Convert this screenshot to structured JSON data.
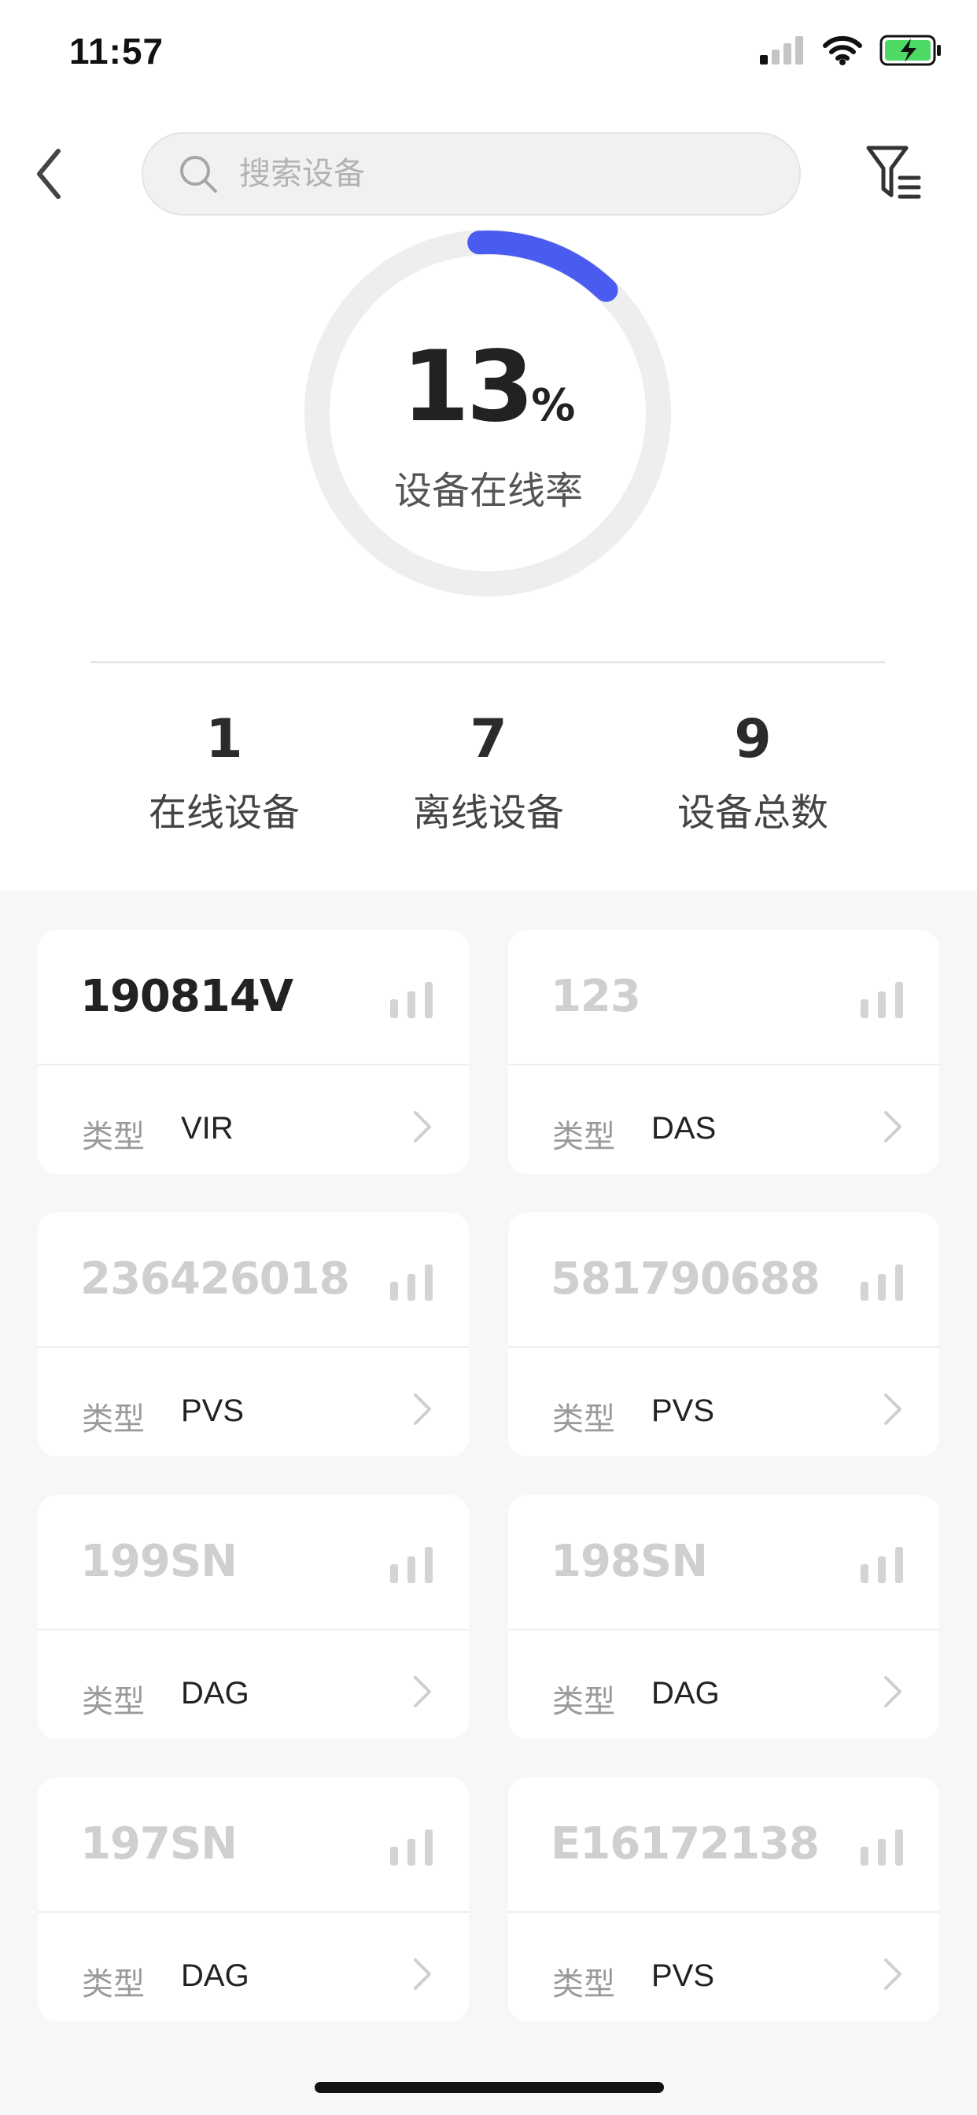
{
  "status_bar": {
    "time": "11:57"
  },
  "search": {
    "placeholder": "搜索设备",
    "value": ""
  },
  "gauge": {
    "rate_value": "13",
    "rate_unit": "%",
    "rate_fraction": 0.13,
    "label": "设备在线率"
  },
  "stats": [
    {
      "value": "1",
      "label": "在线设备"
    },
    {
      "value": "7",
      "label": "离线设备"
    },
    {
      "value": "9",
      "label": "设备总数"
    }
  ],
  "devices": [
    {
      "name": "190814V",
      "type_label": "类型",
      "type": "VIR",
      "online": true
    },
    {
      "name": "123",
      "type_label": "类型",
      "type": "DAS",
      "online": false
    },
    {
      "name": "236426018",
      "type_label": "类型",
      "type": "PVS",
      "online": false
    },
    {
      "name": "581790688",
      "type_label": "类型",
      "type": "PVS",
      "online": false
    },
    {
      "name": "199SN",
      "type_label": "类型",
      "type": "DAG",
      "online": false
    },
    {
      "name": "198SN",
      "type_label": "类型",
      "type": "DAG",
      "online": false
    },
    {
      "name": "197SN",
      "type_label": "类型",
      "type": "DAG",
      "online": false
    },
    {
      "name": "E16172138",
      "type_label": "类型",
      "type": "PVS",
      "online": false
    }
  ],
  "colors": {
    "accent": "#4a5cf0",
    "ring_track": "#eeeeee",
    "online_text": "#222222",
    "offline_text": "#cfcfcf",
    "battery_green": "#4cd964"
  },
  "icons": [
    "back-chevron-icon",
    "search-icon",
    "filter-icon",
    "cellular-signal-icon",
    "wifi-icon",
    "battery-charging-icon",
    "signal-bars-icon",
    "chevron-right-icon"
  ]
}
